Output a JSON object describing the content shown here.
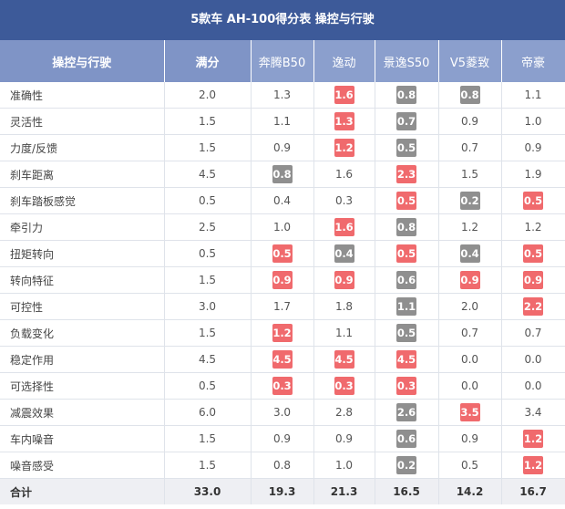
{
  "title": "5款车 AH-100得分表 操控与行驶",
  "colors": {
    "header_bg": "#3d5a99",
    "col_header_bg": "#8b9fcd",
    "best": "#f06a6d",
    "worst": "#8f8f8f",
    "total_row_bg": "#eeeff3"
  },
  "headers": [
    "操控与行驶",
    "满分",
    "奔腾B50",
    "逸动",
    "景逸S50",
    "V5菱致",
    "帝豪"
  ],
  "rows": [
    {
      "name": "准确性",
      "max": "2.0",
      "scores": [
        {
          "v": "1.3",
          "t": ""
        },
        {
          "v": "1.6",
          "t": "red"
        },
        {
          "v": "0.8",
          "t": "gray"
        },
        {
          "v": "0.8",
          "t": "gray"
        },
        {
          "v": "1.1",
          "t": ""
        }
      ]
    },
    {
      "name": "灵活性",
      "max": "1.5",
      "scores": [
        {
          "v": "1.1",
          "t": ""
        },
        {
          "v": "1.3",
          "t": "red"
        },
        {
          "v": "0.7",
          "t": "gray"
        },
        {
          "v": "0.9",
          "t": ""
        },
        {
          "v": "1.0",
          "t": ""
        }
      ]
    },
    {
      "name": "力度/反馈",
      "max": "1.5",
      "scores": [
        {
          "v": "0.9",
          "t": ""
        },
        {
          "v": "1.2",
          "t": "red"
        },
        {
          "v": "0.5",
          "t": "gray"
        },
        {
          "v": "0.7",
          "t": ""
        },
        {
          "v": "0.9",
          "t": ""
        }
      ]
    },
    {
      "name": "刹车距离",
      "max": "4.5",
      "scores": [
        {
          "v": "0.8",
          "t": "gray"
        },
        {
          "v": "1.6",
          "t": ""
        },
        {
          "v": "2.3",
          "t": "red"
        },
        {
          "v": "1.5",
          "t": ""
        },
        {
          "v": "1.9",
          "t": ""
        }
      ]
    },
    {
      "name": "刹车踏板感觉",
      "max": "0.5",
      "scores": [
        {
          "v": "0.4",
          "t": ""
        },
        {
          "v": "0.3",
          "t": ""
        },
        {
          "v": "0.5",
          "t": "red"
        },
        {
          "v": "0.2",
          "t": "gray"
        },
        {
          "v": "0.5",
          "t": "red"
        }
      ]
    },
    {
      "name": "牵引力",
      "max": "2.5",
      "scores": [
        {
          "v": "1.0",
          "t": ""
        },
        {
          "v": "1.6",
          "t": "red"
        },
        {
          "v": "0.8",
          "t": "gray"
        },
        {
          "v": "1.2",
          "t": ""
        },
        {
          "v": "1.2",
          "t": ""
        }
      ]
    },
    {
      "name": "扭矩转向",
      "max": "0.5",
      "scores": [
        {
          "v": "0.5",
          "t": "red"
        },
        {
          "v": "0.4",
          "t": "gray"
        },
        {
          "v": "0.5",
          "t": "red"
        },
        {
          "v": "0.4",
          "t": "gray"
        },
        {
          "v": "0.5",
          "t": "red"
        }
      ]
    },
    {
      "name": "转向特征",
      "max": "1.5",
      "scores": [
        {
          "v": "0.9",
          "t": "red"
        },
        {
          "v": "0.9",
          "t": "red"
        },
        {
          "v": "0.6",
          "t": "gray"
        },
        {
          "v": "0.9",
          "t": "red"
        },
        {
          "v": "0.9",
          "t": "red"
        }
      ]
    },
    {
      "name": "可控性",
      "max": "3.0",
      "scores": [
        {
          "v": "1.7",
          "t": ""
        },
        {
          "v": "1.8",
          "t": ""
        },
        {
          "v": "1.1",
          "t": "gray"
        },
        {
          "v": "2.0",
          "t": ""
        },
        {
          "v": "2.2",
          "t": "red"
        }
      ]
    },
    {
      "name": "负载变化",
      "max": "1.5",
      "scores": [
        {
          "v": "1.2",
          "t": "red"
        },
        {
          "v": "1.1",
          "t": ""
        },
        {
          "v": "0.5",
          "t": "gray"
        },
        {
          "v": "0.7",
          "t": ""
        },
        {
          "v": "0.7",
          "t": ""
        }
      ]
    },
    {
      "name": "稳定作用",
      "max": "4.5",
      "scores": [
        {
          "v": "4.5",
          "t": "red"
        },
        {
          "v": "4.5",
          "t": "red"
        },
        {
          "v": "4.5",
          "t": "red"
        },
        {
          "v": "0.0",
          "t": ""
        },
        {
          "v": "0.0",
          "t": ""
        }
      ]
    },
    {
      "name": "可选择性",
      "max": "0.5",
      "scores": [
        {
          "v": "0.3",
          "t": "red"
        },
        {
          "v": "0.3",
          "t": "red"
        },
        {
          "v": "0.3",
          "t": "red"
        },
        {
          "v": "0.0",
          "t": ""
        },
        {
          "v": "0.0",
          "t": ""
        }
      ]
    },
    {
      "name": "减震效果",
      "max": "6.0",
      "scores": [
        {
          "v": "3.0",
          "t": ""
        },
        {
          "v": "2.8",
          "t": ""
        },
        {
          "v": "2.6",
          "t": "gray"
        },
        {
          "v": "3.5",
          "t": "red"
        },
        {
          "v": "3.4",
          "t": ""
        }
      ]
    },
    {
      "name": "车内噪音",
      "max": "1.5",
      "scores": [
        {
          "v": "0.9",
          "t": ""
        },
        {
          "v": "0.9",
          "t": ""
        },
        {
          "v": "0.6",
          "t": "gray"
        },
        {
          "v": "0.9",
          "t": ""
        },
        {
          "v": "1.2",
          "t": "red"
        }
      ]
    },
    {
      "name": "噪音感受",
      "max": "1.5",
      "scores": [
        {
          "v": "0.8",
          "t": ""
        },
        {
          "v": "1.0",
          "t": ""
        },
        {
          "v": "0.2",
          "t": "gray"
        },
        {
          "v": "0.5",
          "t": ""
        },
        {
          "v": "1.2",
          "t": "red"
        }
      ]
    }
  ],
  "total": {
    "name": "合计",
    "max": "33.0",
    "scores": [
      "19.3",
      "21.3",
      "16.5",
      "14.2",
      "16.7"
    ]
  }
}
